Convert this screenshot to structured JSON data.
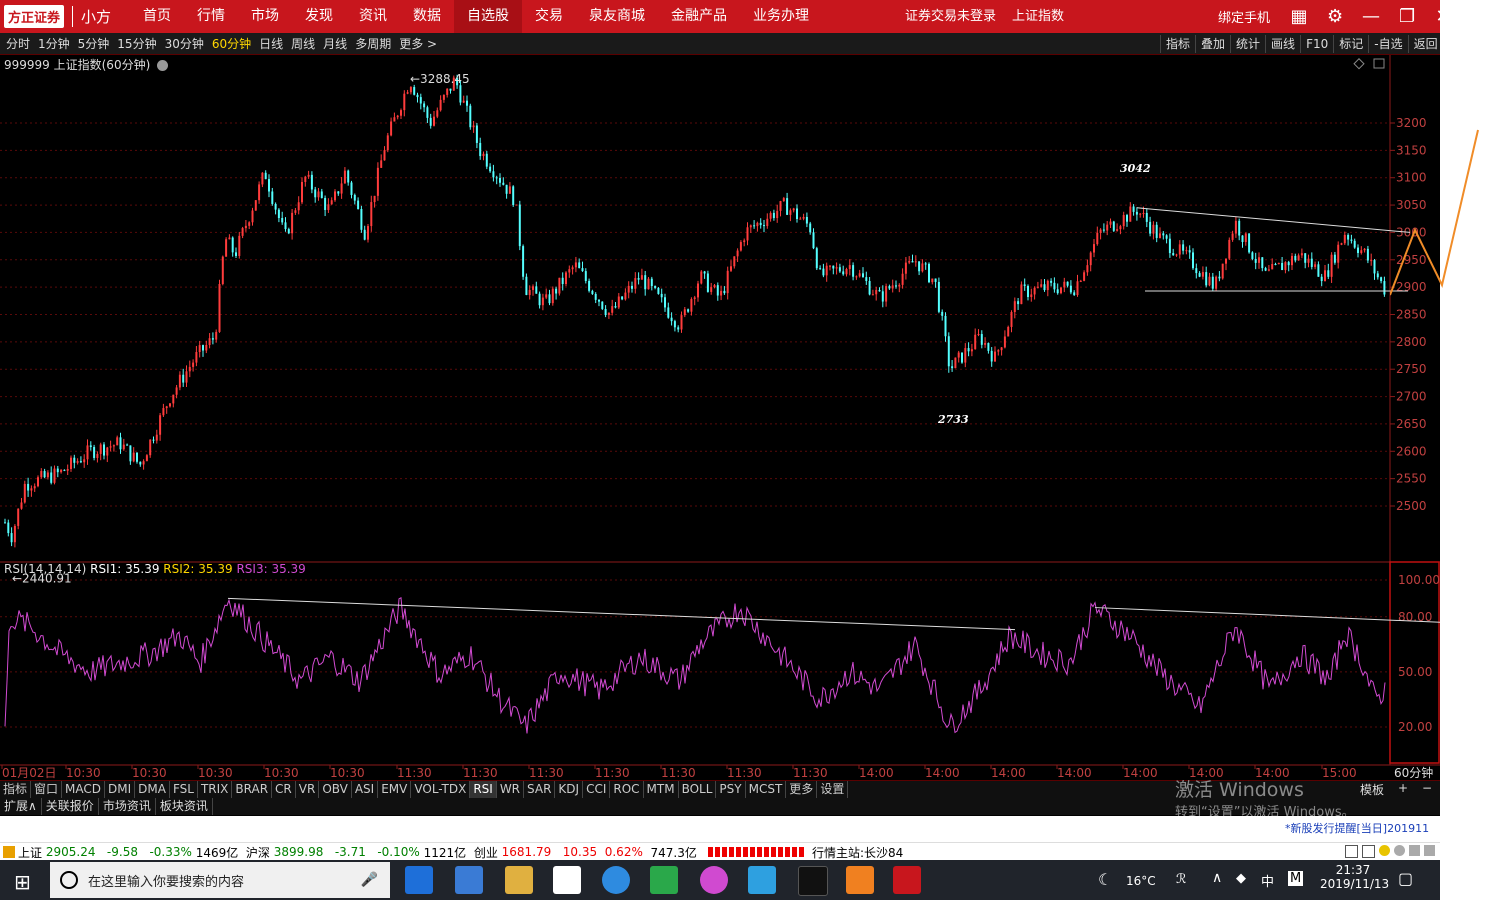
{
  "topbar": {
    "brand": "方正证券",
    "app_name": "小方",
    "nav": [
      "首页",
      "行情",
      "市场",
      "发现",
      "资讯",
      "数据",
      "自选股",
      "交易",
      "泉友商城",
      "金融产品",
      "业务办理"
    ],
    "nav_active": "自选股",
    "login_text": "证券交易未登录",
    "index_text": "上证指数",
    "bind_phone": "绑定手机"
  },
  "periodbar": {
    "periods": [
      "分时",
      "1分钟",
      "5分钟",
      "15分钟",
      "30分钟",
      "60分钟",
      "日线",
      "周线",
      "月线",
      "多周期",
      "更多 >"
    ],
    "selected": "60分钟",
    "tools": [
      "指标",
      "叠加",
      "统计",
      "画线",
      "F10",
      "标记",
      "-自选",
      "返回"
    ]
  },
  "main_chart": {
    "title": "999999 上证指数(60分钟)",
    "price_ticks": [
      "3200",
      "3150",
      "3100",
      "3050",
      "3000",
      "2950",
      "2900",
      "2850",
      "2800",
      "2750",
      "2700",
      "2650",
      "2600",
      "2550",
      "2500"
    ],
    "high_label": "3288.45",
    "low_label": "2440.91",
    "annot_3042": "3042",
    "annot_2733": "2733"
  },
  "rsi_chart": {
    "title": "RSI(14,14,14)",
    "rsi1_label": "RSI1: 35.39",
    "rsi2_label": "RSI2: 35.39",
    "rsi3_label": "RSI3: 35.39",
    "ticks": [
      "100.00",
      "80.00",
      "50.00",
      "20.00"
    ]
  },
  "x_axis": {
    "labels": [
      "01月02日",
      "10:30",
      "10:30",
      "10:30",
      "10:30",
      "10:30",
      "11:30",
      "11:30",
      "11:30",
      "11:30",
      "11:30",
      "11:30",
      "11:30",
      "14:00",
      "14:00",
      "14:00",
      "14:00",
      "14:00",
      "14:00",
      "14:00",
      "15:00"
    ],
    "period_label": "60分钟"
  },
  "indicator_tabs": [
    "指标",
    "窗口",
    "MACD",
    "DMI",
    "DMA",
    "FSL",
    "TRIX",
    "BRAR",
    "CR",
    "VR",
    "OBV",
    "ASI",
    "EMV",
    "VOL-TDX",
    "RSI",
    "WR",
    "SAR",
    "KDJ",
    "CCI",
    "ROC",
    "MTM",
    "BOLL",
    "PSY",
    "MCST",
    "更多",
    "设置"
  ],
  "indicator_selected": "RSI",
  "template_label": "模板",
  "ext_tabs": [
    "扩展∧",
    "关联报价",
    "市场资讯",
    "板块资讯"
  ],
  "watermark": {
    "line1": "激活 Windows",
    "line2": "转到“设置”以激活 Windows。"
  },
  "notice": "*新股发行提醒[当日]201911",
  "statusbar": {
    "sh_name": "上证",
    "sh_value": "2905.24",
    "sh_change": "-9.58",
    "sh_pct": "-0.33%",
    "sh_amount": "1469亿",
    "hs_name": "沪深",
    "hs_value": "3899.98",
    "hs_change": "-3.71",
    "hs_pct": "-0.10%",
    "hs_amount": "1121亿",
    "cy_name": "创业",
    "cy_value": "1681.79",
    "cy_change": "10.35",
    "cy_pct": "0.62%",
    "cy_amount": "747.3亿",
    "server": "行情主站:长沙84"
  },
  "taskbar": {
    "search_placeholder": "在这里输入你要搜索的内容",
    "weather": "16°C",
    "ime": "中",
    "time": "21:37",
    "date": "2019/11/13"
  },
  "colors": {
    "red_bar": "#c8161d",
    "candle_up": "#ff3c3c",
    "candle_down": "#54ffff",
    "rsi_line": "#d24bd2",
    "orange_line": "#f08c28"
  }
}
